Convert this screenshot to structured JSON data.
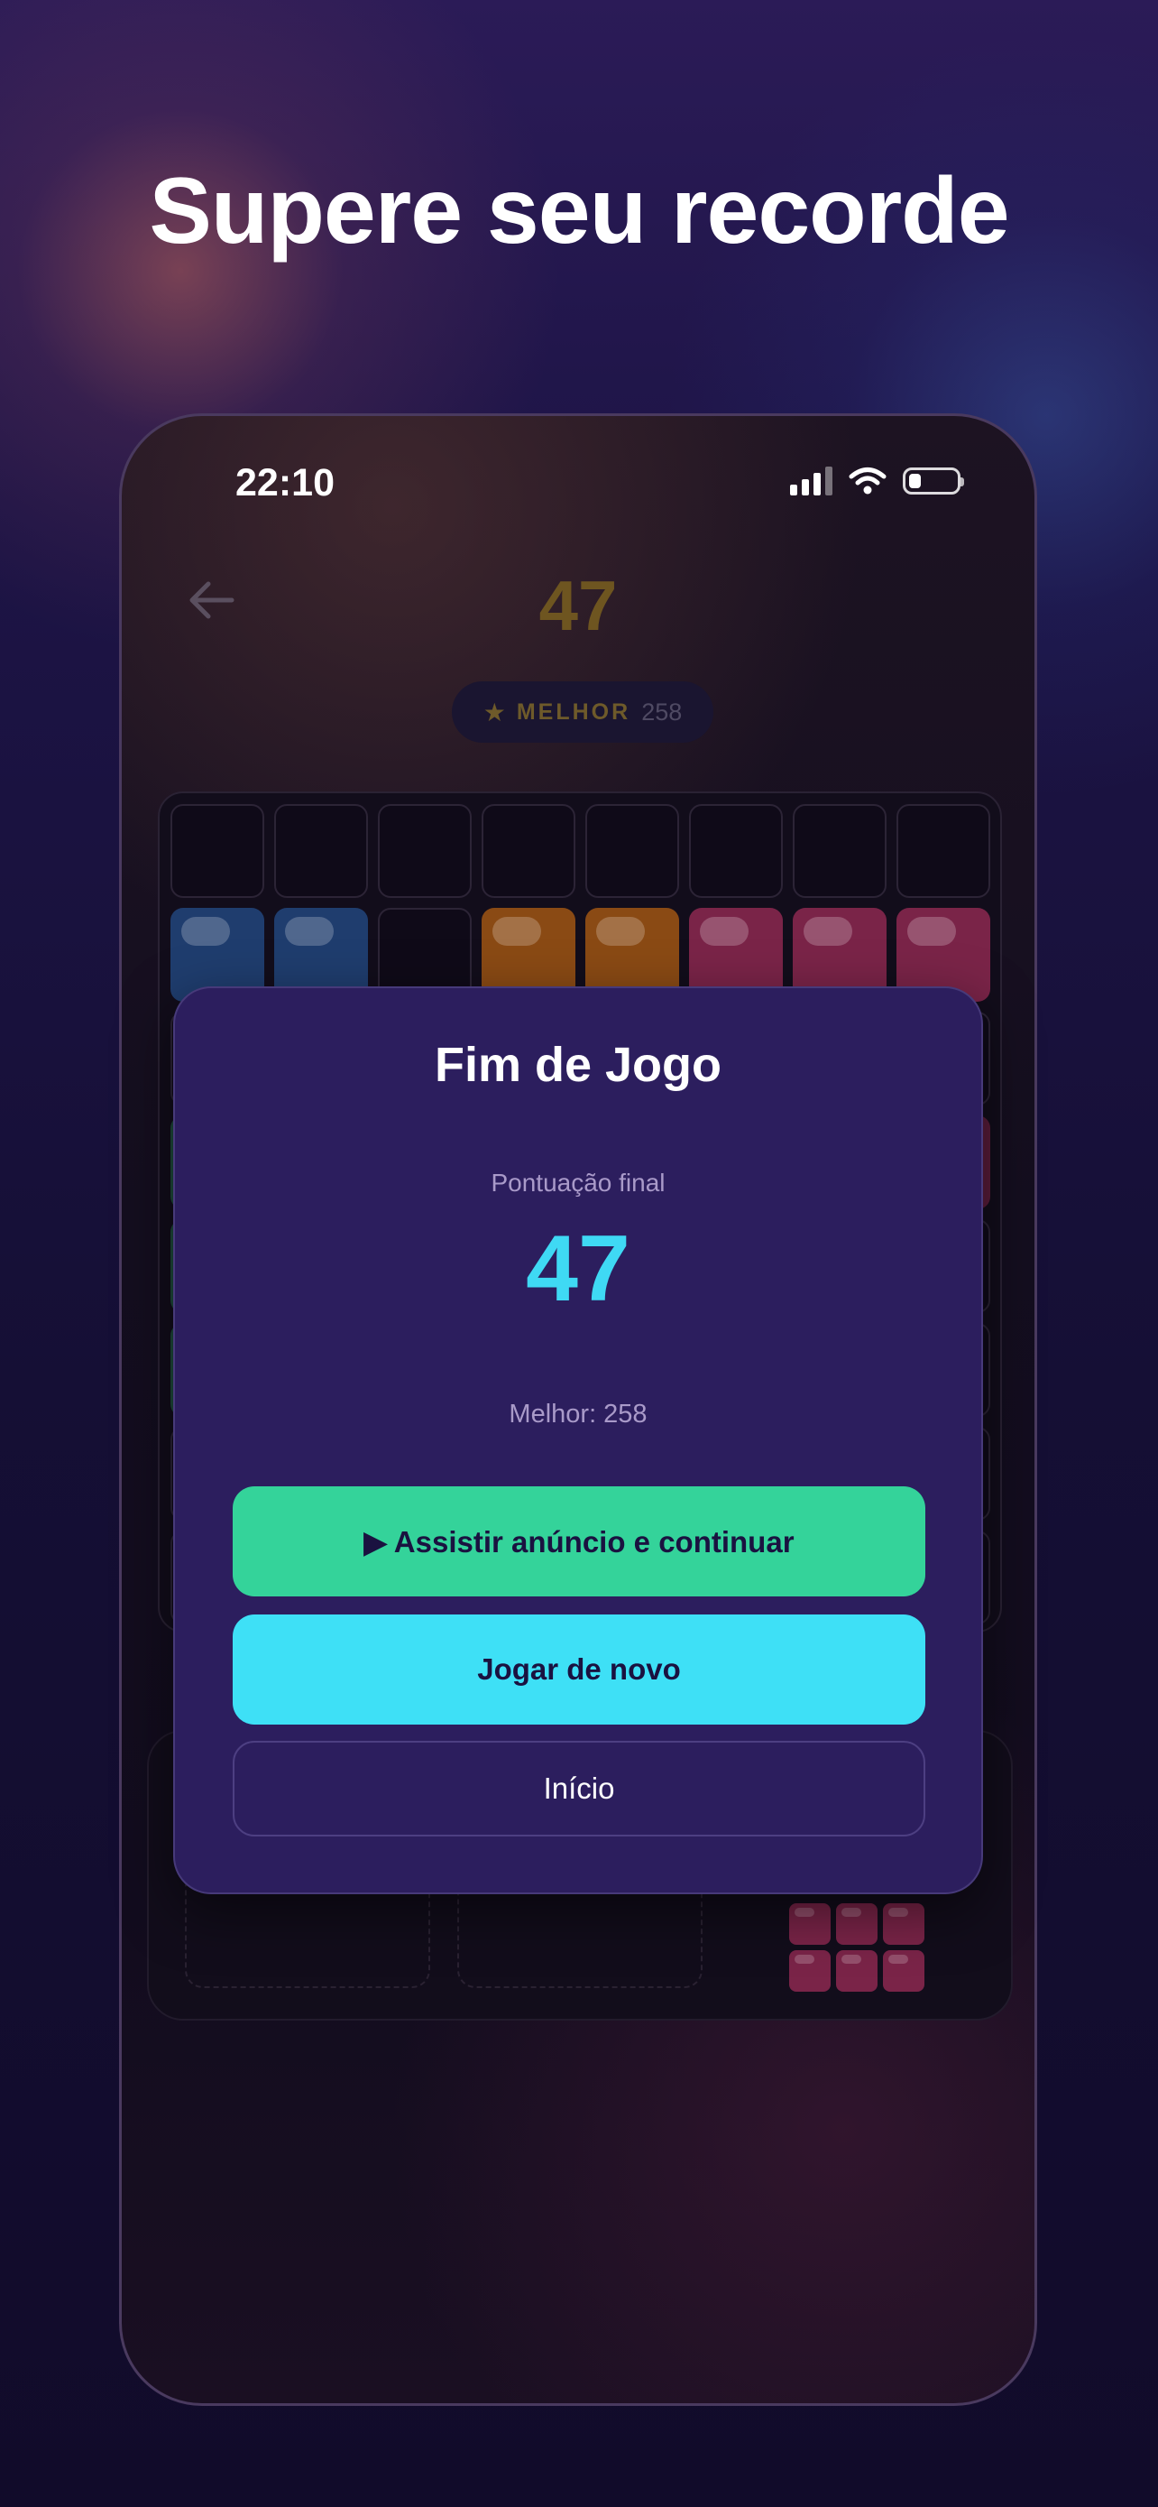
{
  "headline": "Supere seu recorde",
  "status_bar": {
    "time": "22:10",
    "icons": [
      "cellular-signal-icon",
      "wifi-icon",
      "battery-icon"
    ]
  },
  "game_header": {
    "score": "47",
    "best_label": "MELHOR",
    "best_value": "258",
    "icons": [
      "back-arrow-icon",
      "star-icon"
    ]
  },
  "dialog": {
    "title": "Fim de Jogo",
    "score_label": "Pontuação final",
    "score": "47",
    "best_text": "Melhor: 258",
    "watch_ad_label": "▶ Assistir anúncio e continuar",
    "play_again_label": "Jogar de novo",
    "home_label": "Início"
  },
  "colors": {
    "accent_green": "#34d39a",
    "accent_cyan": "#3ee0f6",
    "dialog_bg": "#2c1e5e",
    "block_blue": "#1f3d6e",
    "block_orange": "#8a4a14",
    "block_pink": "#7a2448"
  }
}
